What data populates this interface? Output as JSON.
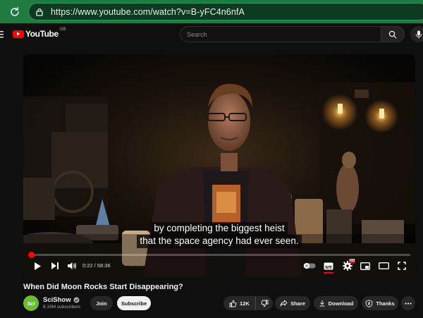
{
  "browser": {
    "url": "https://www.youtube.com/watch?v=B-yFC4n6nfA"
  },
  "header": {
    "logo_text": "YouTube",
    "region": "GB",
    "search_placeholder": "Search"
  },
  "player": {
    "caption_lines": [
      "by completing the biggest heist",
      "that the space agency had ever seen."
    ],
    "current_time": "0:22",
    "duration": "58:36",
    "time_display": "0:22 / 58:36",
    "progress_fraction": 0.006,
    "hd_badge": "HD"
  },
  "video": {
    "title": "When Did Moon Rocks Start Disappearing?"
  },
  "channel": {
    "name": "SciShow",
    "subscribers": "8.19M subscribers",
    "avatar_text": "Sci",
    "join_label": "Join",
    "subscribe_label": "Subscribe"
  },
  "actions": {
    "likes": "12K",
    "share_label": "Share",
    "download_label": "Download",
    "thanks_label": "Thanks"
  },
  "colors": {
    "browser_bar": "#1f7b40",
    "yt_red": "#ff0000",
    "background": "#0f0f0f",
    "pill": "#272727"
  }
}
